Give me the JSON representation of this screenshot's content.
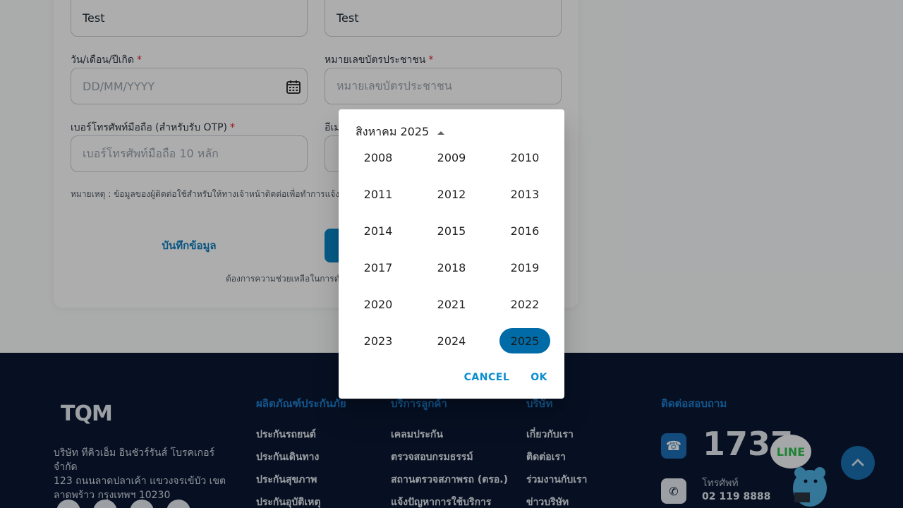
{
  "form": {
    "first_name_value": "Test",
    "last_name_value": "Test",
    "dob_label": "วัน/เดือน/ปีเกิด",
    "dob_placeholder": "DD/MM/YYYY",
    "id_card_label": "หมายเลขบัตรประชาชน",
    "id_card_placeholder": "หมายเลขบัตรประชาชน",
    "phone_label": "เบอร์โทรศัพท์มือถือ (สำหรับรับ OTP)",
    "phone_placeholder": "เบอร์โทรศัพท์มือถือ 10 หลัก",
    "email_label_partial": "อีเม",
    "required_mark": "*",
    "note": "หมายเหตุ : ข้อมูลของผู้ติดต่อใช้สำหรับให้ทางเจ้าหน้าติดต่อเพื่อทำการแจ้งข้อมู",
    "save_label": "บันทึกข้อมูล",
    "help_text": "ต้องการความช่วยเหลือในการดำ"
  },
  "footer": {
    "logo_text": "TQM",
    "address_lines": [
      "บริษัท ทีคิวเอ็ม อินชัวร์รันส์ โบรคเกอร์ จำกัด",
      "123 ถนนลาดปลาเค้า แขวงจรเข้บัว เขต",
      "ลาดพร้าว กรุงเทพฯ 10230"
    ],
    "products_title": "ผลิตภัณฑ์ประกันภัย",
    "products": [
      "ประกันรถยนต์",
      "ประกันเดินทาง",
      "ประกันสุขภาพ",
      "ประกันอุบัติเหตุ"
    ],
    "services_title": "บริการลูกค้า",
    "services": [
      "เคลมประกัน",
      "ตรวจสอบกรมธรรม์",
      "สถานตรวจสภาพรถ (ตรอ.)",
      "แจ้งปัญหาการใช้บริการ"
    ],
    "company_title": "บริษัท",
    "company": [
      "เกี่ยวกับเรา",
      "ติดต่อเรา",
      "ร่วมงานกับเรา",
      "ข่าวบริษัท"
    ],
    "contact_title": "ติดต่อสอบถาม",
    "hotline": "1737",
    "phone_label": "โทรศัพท์",
    "phone_number": "02 119 8888",
    "line_label": "LINE"
  },
  "date_picker": {
    "header_label": "สิงหาคม 2025",
    "years": [
      "2008",
      "2009",
      "2010",
      "2011",
      "2012",
      "2013",
      "2014",
      "2015",
      "2016",
      "2017",
      "2018",
      "2019",
      "2020",
      "2021",
      "2022",
      "2023",
      "2024",
      "2025"
    ],
    "selected_year": "2025",
    "cancel_label": "CANCEL",
    "ok_label": "OK",
    "selected_color": "#006ba6"
  }
}
